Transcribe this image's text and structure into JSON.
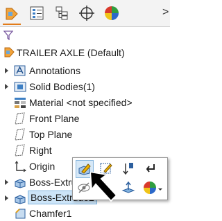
{
  "tabs": [
    {
      "name": "featuremanager-tab",
      "icon": "featuremanager-icon",
      "active": true
    },
    {
      "name": "propertymanager-tab",
      "icon": "propertymanager-icon",
      "active": false
    },
    {
      "name": "configurationmanager-tab",
      "icon": "configurationmanager-icon",
      "active": false
    },
    {
      "name": "dimxpertmanager-tab",
      "icon": "dimxpert-icon",
      "active": false
    },
    {
      "name": "displaymanager-tab",
      "icon": "displaymanager-icon",
      "active": false
    }
  ],
  "overflow_label": ">",
  "filter": {
    "icon": "filter-icon"
  },
  "tree": {
    "root": "TRAILER AXLE  (Default)",
    "items": [
      {
        "label": "Annotations",
        "icon": "annotations-icon",
        "expandable": true
      },
      {
        "label": "Solid Bodies(1)",
        "icon": "solid-bodies-icon",
        "expandable": true
      },
      {
        "label": "Material <not specified>",
        "icon": "material-icon",
        "expandable": false
      },
      {
        "label": "Front Plane",
        "icon": "plane-icon",
        "expandable": false
      },
      {
        "label": "Top Plane",
        "icon": "plane-icon",
        "expandable": false
      },
      {
        "label": "Right",
        "icon": "plane-icon",
        "expandable": false
      },
      {
        "label": "Origin",
        "icon": "origin-icon",
        "expandable": false
      },
      {
        "label": "Boss-Extrude1",
        "icon": "extrude-icon",
        "expandable": true
      },
      {
        "label": "Boss-Extrude2",
        "icon": "extrude-icon",
        "expandable": true,
        "selected": true
      },
      {
        "label": "Chamfer1",
        "icon": "chamfer-icon",
        "expandable": false
      }
    ]
  },
  "context_toolbar": {
    "buttons": [
      {
        "name": "edit-feature-button",
        "icon": "edit-feature-icon"
      },
      {
        "name": "edit-sketch-button",
        "icon": "edit-sketch-icon"
      },
      {
        "name": "rollback-button",
        "icon": "rollback-icon"
      },
      {
        "name": "parent-child-button",
        "icon": "parent-child-icon"
      },
      {
        "name": "hide-button",
        "icon": "hide-icon"
      },
      {
        "name": "normal-to-button",
        "icon": "normal-to-icon"
      },
      {
        "name": "appearance-button",
        "icon": "appearance-icon"
      }
    ]
  },
  "colors": {
    "accent": "#e27c1a",
    "selection": "#cce4f7"
  }
}
